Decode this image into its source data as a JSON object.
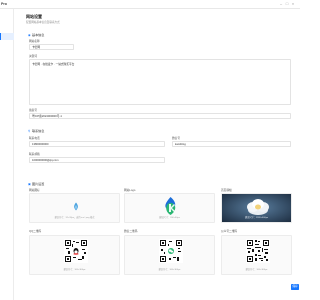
{
  "app": {
    "logo": "Pro"
  },
  "page": {
    "title": "网站设置",
    "description": "配置网站基本信息及联系方式"
  },
  "sections": {
    "basic": "基本信息",
    "contact": "联系信息",
    "images": "图片设置"
  },
  "basic": {
    "site_name_label": "网站名称",
    "site_name_value": "卡密网",
    "keywords_label": "关键词",
    "keywords_value": "卡密网 · 在线发卡 · 一站式购买平台",
    "record_label": "备案号",
    "record_value": "粤ICP备2024000000号-1"
  },
  "contact": {
    "phone_label": "联系电话",
    "phone_value": "13800000000",
    "wechat_label": "微信号",
    "wechat_value": "kamiblog",
    "email_label": "联系邮箱",
    "email_value": "1000000000@qq.com"
  },
  "images": {
    "favicon_label": "网站图标",
    "favicon_caption": "建议尺寸：32×32px，支持 ico / png 格式",
    "logo_label": "网站Logo",
    "logo_caption": "建议尺寸：200×60px",
    "banner_label": "首页横幅",
    "banner_caption": "建议尺寸：1920×600px",
    "qq_qr_label": "QQ二维码",
    "qq_qr_caption": "建议尺寸：300×300px",
    "wechat_qr_label": "微信二维码",
    "wechat_qr_caption": "建议尺寸：300×300px",
    "alipay_qr_label": "公众号二维码",
    "alipay_qr_caption": "建议尺寸：300×300px"
  },
  "actions": {
    "submit": "保存"
  },
  "colors": {
    "accent": "#1677ff",
    "logo_green": "#2bb673",
    "logo_blue": "#1e6fd9"
  }
}
